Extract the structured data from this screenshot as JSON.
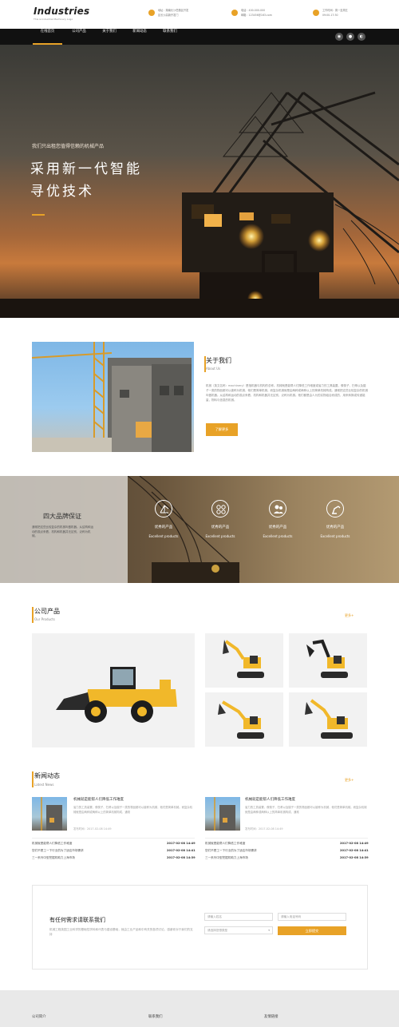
{
  "header": {
    "logo": "Industries",
    "tagline": "This is Industrial Machinery Logo",
    "info": [
      {
        "icon": "location-pin-icon",
        "line1": "地址：湖南长沙岳麓区开发",
        "line2": "区长沙高新开发门"
      },
      {
        "icon": "phone-icon",
        "line1": "电话：400-000-000",
        "line2": "邮箱：123456@163.com"
      },
      {
        "icon": "clock-icon",
        "line1": "工作时间：周一至周五",
        "line2": "09:00-17:30"
      }
    ]
  },
  "nav": {
    "items": [
      "在线首页",
      "公司产品",
      "关于我们",
      "新闻动态",
      "联系我们"
    ],
    "social": [
      "weibo-icon",
      "wechat-icon",
      "qq-icon"
    ]
  },
  "hero": {
    "subtitle": "我们只出租您值得信赖的机械产品",
    "title_line1": "采用新一代智能",
    "title_line2": "寻优技术"
  },
  "about": {
    "title": "关于我们",
    "title_en": "About Us",
    "text": "机械（英文名称：machinery）是指机器与机构的总称。机械就是能帮人们降低工作难度或省力的工具装置，像筷子、扫帚以及镊子一类的物品都可以被称为机械，他们是简单机械。而复杂机械就是由两种或两种以上的简单机械构成。通常把这些比较复杂的机械叫做机器。从结构和运动的观点来看，机构和机器并无区别，泛称为机械。他们都是由人为的实物组合而成的，用来转换或传递能量，物料与信息的机械。",
    "button": "了解更多"
  },
  "guarantee": {
    "title": "四大品牌保证",
    "text": "通常把这些比较复杂的机械叫做机器。从结构和运动的观点来看，机构和机器并无区别，泛称为机械。",
    "features": [
      {
        "icon": "crane-icon",
        "cn": "优秀的产品",
        "en": "Excellent products"
      },
      {
        "icon": "gear-grid-icon",
        "cn": "优秀的产品",
        "en": "Excellent products"
      },
      {
        "icon": "team-icon",
        "cn": "优秀的产品",
        "en": "Excellent products"
      },
      {
        "icon": "robot-arm-icon",
        "cn": "优秀的产品",
        "en": "Excellent products"
      }
    ]
  },
  "products": {
    "title": "公司产品",
    "title_en": "Our Products",
    "more": "更多+"
  },
  "news": {
    "title": "新闻动态",
    "title_en": "Latest News",
    "more": "更多+",
    "featured": [
      {
        "title": "机械就是能帮人们降低工作难度",
        "text": "省力的工具装置，像筷子、扫帚以及镊子一类的物品都可以被称为机械，他们是简单机械。而复杂机械就是由两种或两种以上的简单机械构成，通常",
        "date": "发布时间：2017-02-08 14:49"
      },
      {
        "title": "机械就是能帮人们降低工作难度",
        "text": "省力的工具装置，像筷子、扫帚以及镊子一类的物品都可以被称为机械，他们是简单机械。而复杂机械就是由两种或两种以上的简单机械构成，通常",
        "date": "发布时间：2017-02-08 14:49"
      }
    ],
    "list": [
      {
        "title": "机械就是能帮人们降低工作难度",
        "date": "2017-02-08 14:49"
      },
      {
        "title": "您们不是工一下行业的为了适应市场需求",
        "date": "2017-02-08 14:41"
      },
      {
        "title": "三一系列中型挖掘机助力上海市场",
        "date": "2017-02-08 14:39"
      }
    ]
  },
  "contact": {
    "title": "有任何需求请联系我们",
    "text": "机械工程英国工业科学的基础性学科和代表与建设基础，就由工业产品和中有关的各项讨论，感谢你对于我们的支持",
    "name_placeholder": "请输入姓名",
    "phone_placeholder": "请输入电话号码",
    "select": "请选择您想类型",
    "submit": "立即提交"
  },
  "footer": {
    "cols": [
      "公司简介",
      "联系我们",
      "友情链接"
    ]
  },
  "colors": {
    "accent": "#e8a227",
    "nav": "#111111"
  }
}
